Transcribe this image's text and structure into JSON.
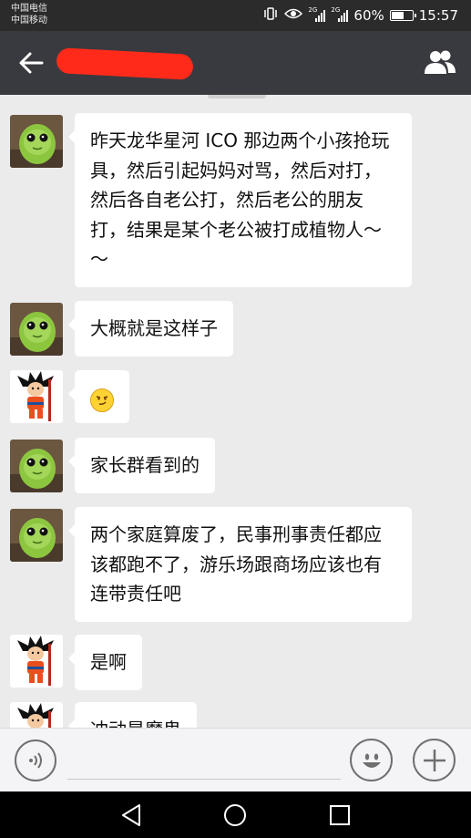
{
  "status_bar": {
    "carrier_1": "中国电信",
    "carrier_2": "中国移动",
    "signal_tag_1": "2G",
    "signal_tag_2": "2G",
    "battery_level": 60,
    "battery_text": "60%",
    "time": "15:57",
    "icons": [
      "vibrate-icon",
      "eye-icon",
      "signal-icon",
      "signal-icon",
      "battery-icon"
    ]
  },
  "title_bar": {
    "chat_title": "",
    "title_redacted": true,
    "back_icon": "arrow-left-icon",
    "group_icon": "group-members-icon"
  },
  "messages": [
    {
      "sender": "green-plush",
      "text": "昨天龙华星河 ICO 那边两个小孩抢玩具，然后引起妈妈对骂，然后对打，然后各自老公打，然后老公的朋友打，结果是某个老公被打成植物人～～"
    },
    {
      "sender": "green-plush",
      "text": "大概就是这样子"
    },
    {
      "sender": "goku",
      "text": "",
      "emoji": "smirk-face-emoji"
    },
    {
      "sender": "green-plush",
      "text": "家长群看到的"
    },
    {
      "sender": "green-plush",
      "text": "两个家庭算废了，民事刑事责任都应该都跑不了，游乐场跟商场应该也有连带责任吧"
    },
    {
      "sender": "goku",
      "text": "是啊"
    },
    {
      "sender": "goku",
      "text": "冲动是魔鬼"
    }
  ],
  "input_bar": {
    "value": "",
    "placeholder": "",
    "voice_icon": "voice-icon",
    "emoji_icon": "emoji-icon",
    "plus_icon": "plus-icon"
  },
  "nav_bar": {
    "icons": [
      "back-triangle-icon",
      "home-circle-icon",
      "recents-square-icon"
    ]
  },
  "colors": {
    "title_bar": "#393a3f",
    "status_bar": "#2b2b2b",
    "chat_bg": "#ebebeb",
    "bubble": "#ffffff",
    "redaction": "#ff2a1a"
  }
}
